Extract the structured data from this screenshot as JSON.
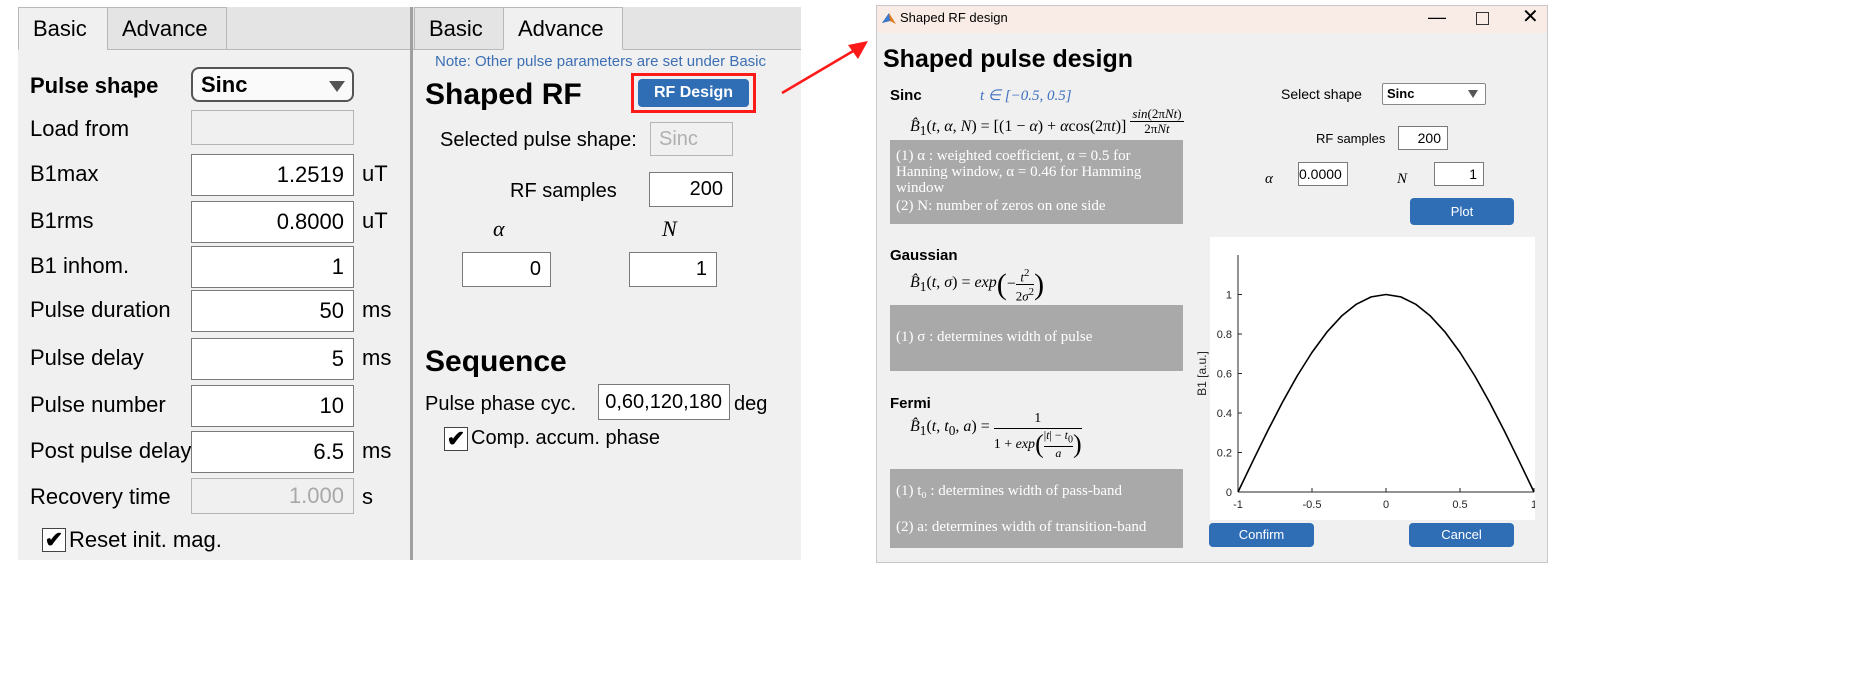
{
  "left_panel": {
    "tabs": [
      "Basic",
      "Advance"
    ],
    "pulse_shape": {
      "label": "Pulse shape",
      "value": "Sinc"
    },
    "load_from": {
      "label": "Load from",
      "value": ""
    },
    "fields": [
      {
        "label": "B1max",
        "value": "1.2519",
        "unit": "uT"
      },
      {
        "label": "B1rms",
        "value": "0.8000",
        "unit": "uT"
      },
      {
        "label": "B1 inhom.",
        "value": "1",
        "unit": ""
      },
      {
        "label": "Pulse duration",
        "value": "50",
        "unit": "ms"
      },
      {
        "label": "Pulse delay",
        "value": "5",
        "unit": "ms"
      },
      {
        "label": "Pulse number",
        "value": "10",
        "unit": ""
      },
      {
        "label": "Post pulse delay",
        "value": "6.5",
        "unit": "ms"
      }
    ],
    "recovery": {
      "label": "Recovery time",
      "value": "1.000",
      "unit": "s"
    },
    "reset_checkbox": {
      "label": "Reset init. mag.",
      "checked": true
    }
  },
  "mid_panel": {
    "tabs": [
      "Basic",
      "Advance"
    ],
    "note": "Note: Other pulse parameters are set under Basic",
    "shaped_rf_title": "Shaped RF",
    "rf_design_button": "RF Design",
    "selected_pulse_shape": {
      "label": "Selected pulse shape:",
      "value": "Sinc"
    },
    "rf_samples": {
      "label": "RF samples",
      "value": "200"
    },
    "alpha": {
      "label": "α",
      "value": "0"
    },
    "n": {
      "label": "N",
      "value": "1"
    },
    "sequence_title": "Sequence",
    "pulse_phase": {
      "label": "Pulse phase cyc.",
      "value": "0,60,120,180",
      "unit": "deg"
    },
    "comp_checkbox": {
      "label": "Comp. accum. phase",
      "checked": true
    }
  },
  "dialog": {
    "title": "Shaped RF design",
    "heading": "Shaped pulse design",
    "sinc": {
      "name": "Sinc",
      "range": "t ∈ [−0.5, 0.5]",
      "desc1": "(1) α : weighted coefficient, α = 0.5 for Hanning window, α = 0.46 for Hamming window",
      "desc2": "(2) N: number of zeros on one side"
    },
    "gaussian": {
      "name": "Gaussian",
      "desc1": "(1) σ : determines width of pulse"
    },
    "fermi": {
      "name": "Fermi",
      "desc1": "(1) t₀ : determines width of pass-band",
      "desc2": "(2) a: determines width of transition-band"
    },
    "select_shape": {
      "label": "Select shape",
      "value": "Sinc"
    },
    "rf_samples": {
      "label": "RF samples",
      "value": "200"
    },
    "alpha": {
      "label": "α",
      "value": "0.0000"
    },
    "n": {
      "label": "N",
      "value": "1"
    },
    "plot_button": "Plot",
    "confirm_button": "Confirm",
    "cancel_button": "Cancel"
  },
  "colors": {
    "accent_blue": "#2f6db5",
    "highlight_red": "#ff1a1a",
    "desc_gray": "#a9a9a9",
    "panel_gray": "#f0f0f0"
  },
  "chart_data": {
    "type": "line",
    "title": "",
    "xlabel": "",
    "ylabel": "B1 [a.u.]",
    "xlim": [
      -1,
      1
    ],
    "ylim": [
      0,
      1.2
    ],
    "x_ticks": [
      -1,
      -0.5,
      0,
      0.5,
      1
    ],
    "x_tick_labels": [
      "-1",
      "-0.5",
      "0",
      "0.5",
      "1"
    ],
    "y_ticks": [
      0,
      0.2,
      0.4,
      0.6,
      0.8,
      1
    ],
    "y_tick_labels": [
      "0",
      "0.2",
      "0.4",
      "0.6",
      "0.8",
      "1"
    ],
    "grid": false,
    "series": [
      {
        "x": [
          -1,
          -0.9,
          -0.8,
          -0.7,
          -0.6,
          -0.5,
          -0.4,
          -0.3,
          -0.2,
          -0.1,
          0,
          0.1,
          0.2,
          0.3,
          0.4,
          0.5,
          0.6,
          0.7,
          0.8,
          0.9,
          1
        ],
        "y": [
          0,
          0.156,
          0.309,
          0.454,
          0.588,
          0.707,
          0.809,
          0.891,
          0.951,
          0.988,
          1,
          0.988,
          0.951,
          0.891,
          0.809,
          0.707,
          0.588,
          0.454,
          0.309,
          0.156,
          0
        ]
      }
    ]
  }
}
